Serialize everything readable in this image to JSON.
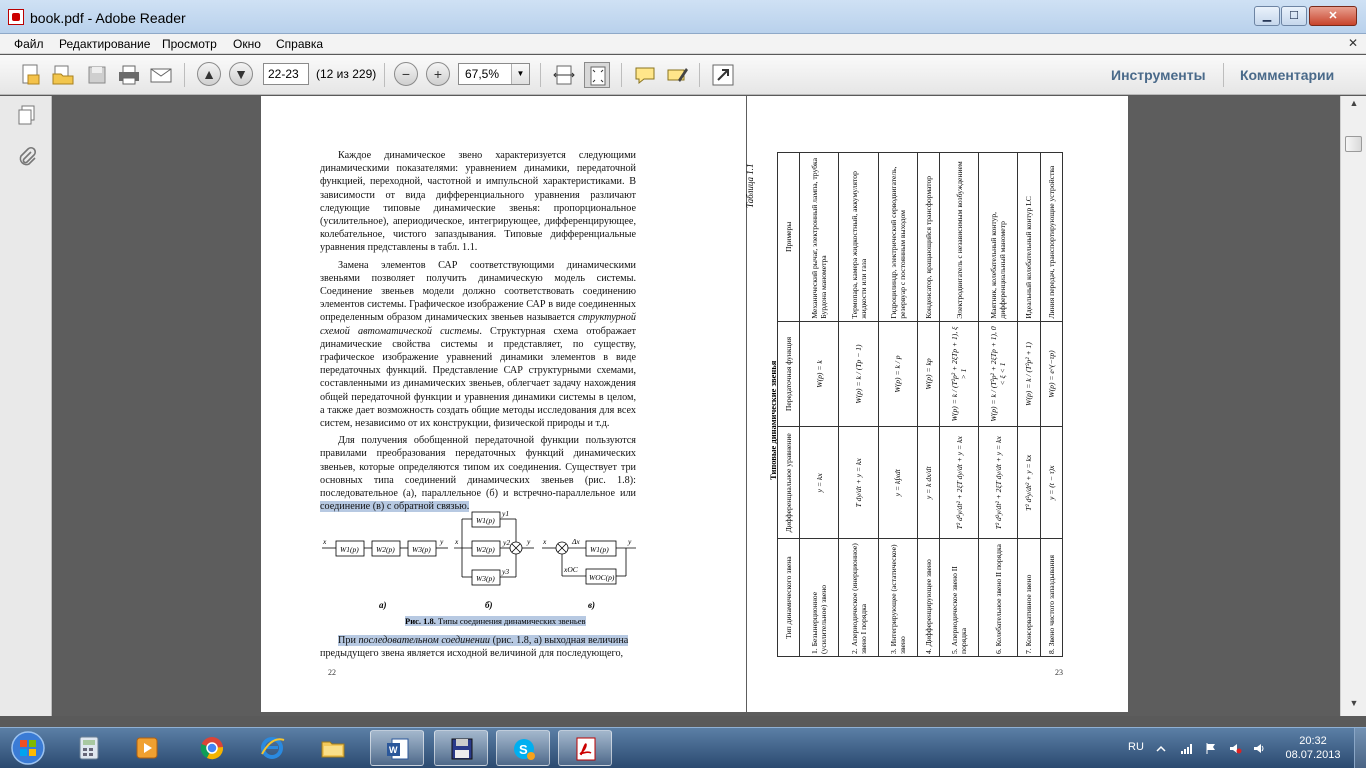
{
  "window": {
    "title": "book.pdf - Adobe Reader",
    "min_glyph": "▁",
    "max_glyph": "☐",
    "close_glyph": "✕"
  },
  "menu": {
    "items": [
      "Файл",
      "Редактирование",
      "Просмотр",
      "Окно",
      "Справка"
    ],
    "close_glyph": "✕"
  },
  "toolbar": {
    "page_value": "22-23",
    "page_count": "(12 из 229)",
    "zoom_value": "67,5%",
    "zoom_arrow": "▼",
    "tools_label": "Инструменты",
    "comments_label": "Комментарии",
    "prev_glyph": "▲",
    "next_glyph": "▼",
    "zoom_out_glyph": "−",
    "zoom_in_glyph": "+"
  },
  "doc": {
    "left_page": {
      "paragraphs": [
        "Каждое динамическое звено характеризуется следующими динамическими показателями: уравнением динамики, передаточной функцией, переходной, частотной и импульсной характеристиками. В зависимости от вида дифференциального уравнения различают следующие типовые динамические звенья: пропорциональное (усилительное), апериодическое, интегрирующее, дифференцирующее, колебательное, чистого запаздывания. Типовые дифференциальные уравнения представлены в табл. 1.1.",
        "Замена элементов САР соответствующими динамическими звеньями позволяет получить динамическую модель системы. Соединение звеньев модели должно соответствовать соединению элементов системы. Графическое изображение САР в виде соединенных определенным образом динамических звеньев называется",
        "структурной схемой автоматической системы",
        ". Структурная схема отображает динамические свойства системы и представляет, по существу, графическое изображение уравнений динамики элементов в виде передаточных функций. Представление САР структурными схемами, составленными из динамических звеньев, облегчает задачу нахождения общей передаточной функции и уравнения динамики системы в целом, а также дает возможность создать общие методы исследования для всех систем, независимо от их конструкции, физической природы и т.д.",
        "Для получения обобщенной передаточной функции пользуются правилами преобразования передаточных функций динамических звеньев, которые определяются типом их соединения. Существует три основных типа соединений динамических звеньев (рис. 1.8): последовательное (а), параллельное (б) и встречно-параллельное или",
        "соединение (в) с обратной связью."
      ],
      "figure_caption_bold": "Рис. 1.8.",
      "figure_caption": "Типы соединения динамических звеньев",
      "fig_letters": [
        "а)",
        "б)",
        "в)"
      ],
      "last_para_start": "При",
      "last_para_em": "последовательном соединении",
      "last_para_rest": "(рис. 1.8, а) выходная величина",
      "last_line": "предыдущего звена является исходной величиной для последующего,",
      "page_number": "22",
      "diagram": {
        "series_blocks": [
          "W1(p)",
          "W2(p)",
          "W3(p)"
        ],
        "parallel_blocks": [
          "W1(p)",
          "W2(p)",
          "W3(p)"
        ],
        "feedback_forward": "W1(p)",
        "feedback_back": "WOC(p)",
        "labels": [
          "x",
          "y",
          "y1",
          "y2",
          "y3",
          "Δx",
          "xOC"
        ]
      }
    },
    "right_page": {
      "table_label": "Таблица 1.1",
      "table_title": "Типовые динамические звенья",
      "headers": [
        "Тип динамического звена",
        "Дифференциальное уравнение",
        "Передаточная функция",
        "Примеры"
      ],
      "rows": [
        [
          "1. Безынерционное (усилительное) звено",
          "y = kx",
          "W(p) = k",
          "Механический рычаг, электронный лампа, трубка Бурдона манометра"
        ],
        [
          "2. Апериодическое (инерционное) звено I порядка",
          "T dy/dt + y = kx",
          "W(p) = k / (Tp − 1)",
          "Термопара, камера жидкостный, аккумулятор жидкости или газа"
        ],
        [
          "3. Интегрирующее (астатическое) звено",
          "y = k∫xdt",
          "W(p) = k / p",
          "Гидроцилиндр, электрический серводвигатель, резервуар с постоянным выходом"
        ],
        [
          "4. Дифференцирующее звено",
          "y = k dx/dt",
          "W(p) = kp",
          "Конденсатор, вращающийся трансформатор"
        ],
        [
          "5. Апериодическое звено II порядка",
          "T² d²y/dt² + 2ξT dy/dt + y = kx",
          "W(p) = k / (T²p² + 2ξTp + 1), ξ > 1",
          "Электродвигатель с независимым возбуждением"
        ],
        [
          "6. Колебательное звено II порядка",
          "T² d²y/dt² + 2ξT dy/dt + y = kx",
          "W(p) = k / (T²p² + 2ξTp + 1), 0 < ξ < 1",
          "Маятник, колебательный контур, дифференциальный манометр"
        ],
        [
          "7. Консервативное звено",
          "T² d²y/dt² + y = kx",
          "W(p) = k / (T²p² + 1)",
          "Идеальный колебательный контур LC"
        ],
        [
          "8. Звено чистого запаздывания",
          "y = (t − τ)x",
          "W(p) = e^(−τp)",
          "Линия передач, транспортирующие устройства"
        ]
      ],
      "page_number": "23"
    }
  },
  "taskbar": {
    "language": "RU",
    "time": "20:32",
    "date": "08.07.2013"
  },
  "colors": {
    "highlight": "#b7c9e2",
    "doc_background": "#5d5d5d",
    "pane_link": "#4a6a8a"
  }
}
